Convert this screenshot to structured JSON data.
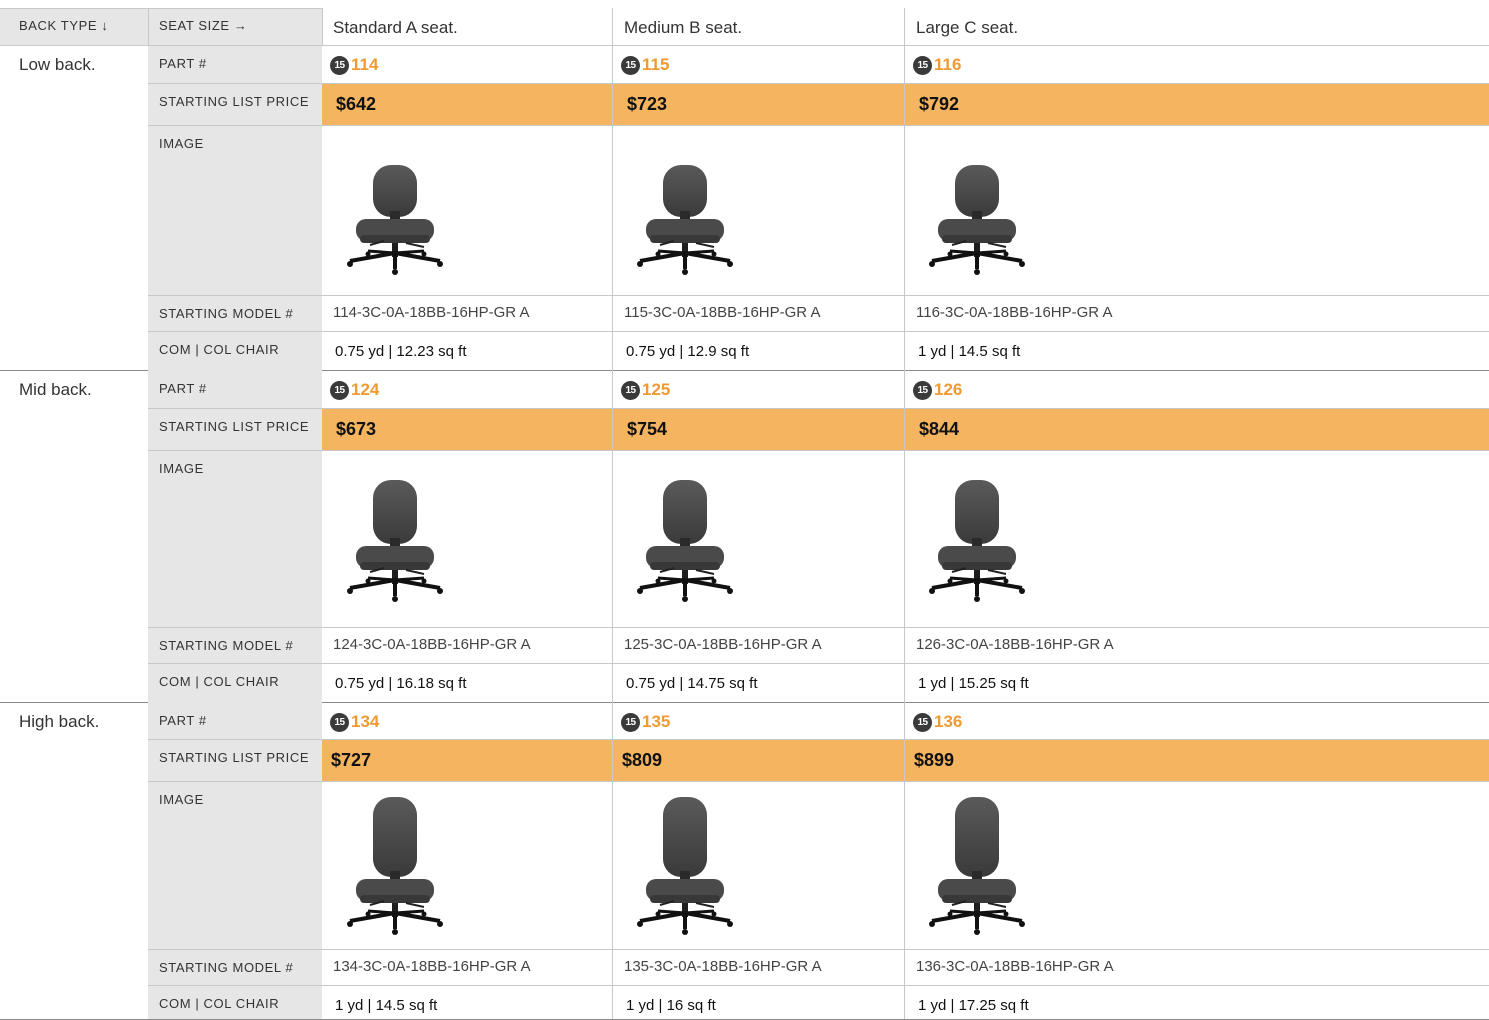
{
  "header": {
    "back_type_label": "BACK TYPE ↓",
    "seat_size_label": "SEAT SIZE →",
    "columns": [
      "Standard A seat.",
      "Medium B seat.",
      "Large C seat."
    ]
  },
  "row_labels": {
    "part": "PART #",
    "price": "STARTING LIST PRICE",
    "image": "IMAGE",
    "model": "STARTING MODEL #",
    "com": "COM | COL CHAIR"
  },
  "badge_text": "15",
  "colors": {
    "price_band": "#f4b460",
    "part_number": "#f09a33",
    "label_column": "#e6e6e6"
  },
  "groups": [
    {
      "name": "Low back.",
      "back_style": "low",
      "cells": [
        {
          "part": "114",
          "price": "$642",
          "model": "114-3C-0A-18BB-16HP-GR A",
          "com": "0.75 yd | 12.23 sq ft"
        },
        {
          "part": "115",
          "price": "$723",
          "model": "115-3C-0A-18BB-16HP-GR A",
          "com": "0.75 yd | 12.9 sq ft"
        },
        {
          "part": "116",
          "price": "$792",
          "model": "116-3C-0A-18BB-16HP-GR A",
          "com": "1 yd | 14.5 sq ft"
        }
      ]
    },
    {
      "name": "Mid back.",
      "back_style": "mid",
      "cells": [
        {
          "part": "124",
          "price": "$673",
          "model": "124-3C-0A-18BB-16HP-GR A",
          "com": "0.75 yd | 16.18 sq ft"
        },
        {
          "part": "125",
          "price": "$754",
          "model": "125-3C-0A-18BB-16HP-GR A",
          "com": "0.75 yd | 14.75 sq ft"
        },
        {
          "part": "126",
          "price": "$844",
          "model": "126-3C-0A-18BB-16HP-GR A",
          "com": "1 yd | 15.25 sq ft"
        }
      ]
    },
    {
      "name": "High back.",
      "back_style": "high",
      "cells": [
        {
          "part": "134",
          "price": "$727",
          "model": "134-3C-0A-18BB-16HP-GR A",
          "com": "1 yd | 14.5 sq ft"
        },
        {
          "part": "135",
          "price": "$809",
          "model": "135-3C-0A-18BB-16HP-GR A",
          "com": "1 yd | 16 sq ft"
        },
        {
          "part": "136",
          "price": "$899",
          "model": "136-3C-0A-18BB-16HP-GR A",
          "com": "1 yd | 17.25 sq ft"
        }
      ]
    }
  ]
}
